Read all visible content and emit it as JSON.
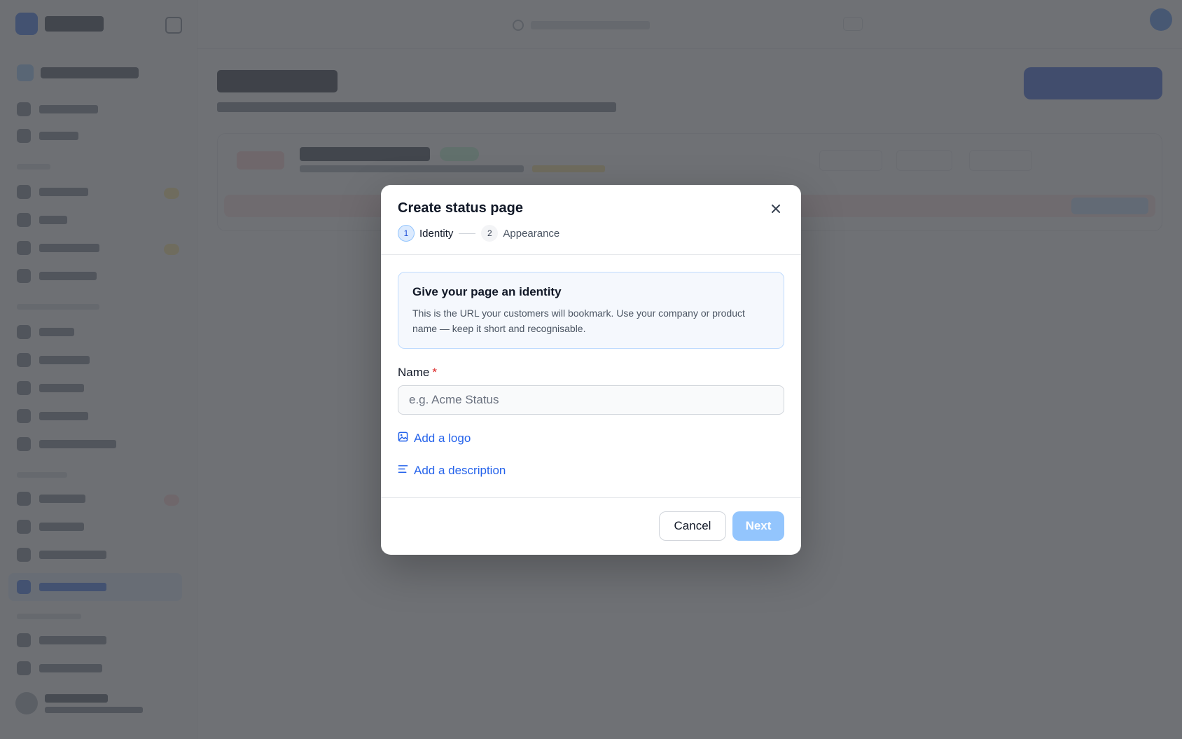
{
  "modal": {
    "title": "Create status page",
    "steps": [
      {
        "number": "1",
        "label": "Identity",
        "active": true
      },
      {
        "number": "2",
        "label": "Appearance",
        "active": false
      }
    ],
    "info": {
      "title": "Give your page an identity",
      "text": "This is the URL your customers will bookmark. Use your company or product name — keep it short and recognisable."
    },
    "name_field": {
      "label": "Name",
      "required_marker": "*",
      "value": "",
      "placeholder": "e.g. Acme Status"
    },
    "add_logo_label": "Add a logo",
    "add_description_label": "Add a description",
    "cancel_label": "Cancel",
    "next_label": "Next"
  },
  "colors": {
    "accent": "#2563eb",
    "next_disabled": "#93c5fd",
    "overlay": "#4b4e52",
    "required": "#dc2626"
  },
  "icons": {
    "close": "close-icon",
    "add_logo": "image-icon",
    "add_description": "text-lines-icon"
  }
}
